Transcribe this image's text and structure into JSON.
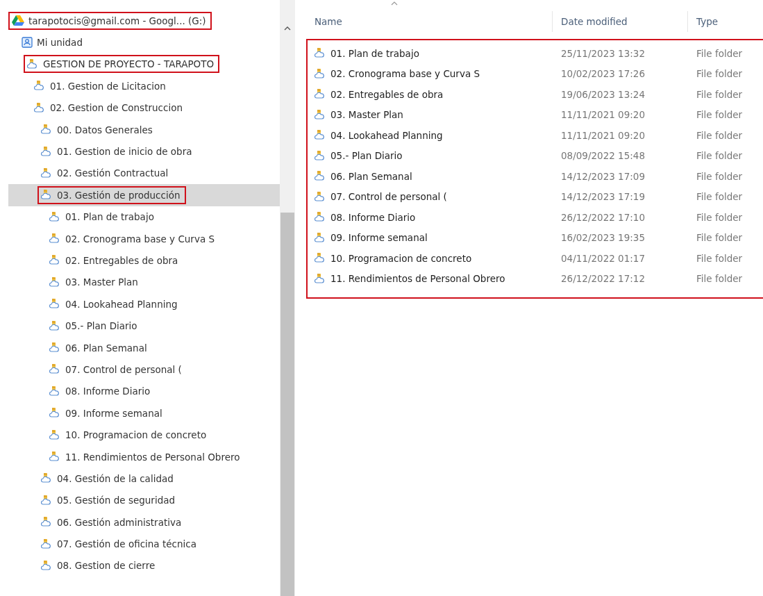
{
  "tree": [
    {
      "label": "tarapotocis@gmail.com - Googl... (G:)",
      "kind": "drive",
      "selected": false,
      "annotated": true,
      "children": [
        {
          "label": "Mi unidad",
          "kind": "mydrive",
          "selected": false,
          "annotated": false,
          "children": [
            {
              "label": "GESTION DE PROYECTO - TARAPOTO",
              "kind": "folder",
              "selected": false,
              "annotated": true,
              "children": [
                {
                  "label": "01. Gestion de Licitacion",
                  "kind": "folder",
                  "selected": false,
                  "annotated": false
                },
                {
                  "label": "02. Gestion de Construccion",
                  "kind": "folder",
                  "selected": false,
                  "annotated": false,
                  "children": [
                    {
                      "label": "00. Datos Generales",
                      "kind": "folder",
                      "selected": false,
                      "annotated": false
                    },
                    {
                      "label": "01. Gestion de inicio de obra",
                      "kind": "folder",
                      "selected": false,
                      "annotated": false
                    },
                    {
                      "label": "02. Gestión Contractual",
                      "kind": "folder",
                      "selected": false,
                      "annotated": false
                    },
                    {
                      "label": "03. Gestión de producción",
                      "kind": "folder",
                      "selected": true,
                      "annotated": true,
                      "children": [
                        {
                          "label": "01. Plan de trabajo",
                          "kind": "folder",
                          "selected": false,
                          "annotated": false
                        },
                        {
                          "label": "02. Cronograma base  y Curva S",
                          "kind": "folder",
                          "selected": false,
                          "annotated": false
                        },
                        {
                          "label": "02. Entregables de obra",
                          "kind": "folder",
                          "selected": false,
                          "annotated": false
                        },
                        {
                          "label": "03. Master Plan",
                          "kind": "folder",
                          "selected": false,
                          "annotated": false
                        },
                        {
                          "label": "04. Lookahead Planning",
                          "kind": "folder",
                          "selected": false,
                          "annotated": false
                        },
                        {
                          "label": "05.- Plan Diario",
                          "kind": "folder",
                          "selected": false,
                          "annotated": false
                        },
                        {
                          "label": "06. Plan Semanal",
                          "kind": "folder",
                          "selected": false,
                          "annotated": false
                        },
                        {
                          "label": "07. Control de personal (",
                          "kind": "folder",
                          "selected": false,
                          "annotated": false
                        },
                        {
                          "label": "08. Informe Diario",
                          "kind": "folder",
                          "selected": false,
                          "annotated": false
                        },
                        {
                          "label": "09. Informe semanal",
                          "kind": "folder",
                          "selected": false,
                          "annotated": false
                        },
                        {
                          "label": "10. Programacion de concreto",
                          "kind": "folder",
                          "selected": false,
                          "annotated": false
                        },
                        {
                          "label": "11. Rendimientos de Personal Obrero",
                          "kind": "folder",
                          "selected": false,
                          "annotated": false
                        }
                      ]
                    },
                    {
                      "label": "04. Gestión de la calidad",
                      "kind": "folder",
                      "selected": false,
                      "annotated": false
                    },
                    {
                      "label": "05. Gestión de seguridad",
                      "kind": "folder",
                      "selected": false,
                      "annotated": false
                    },
                    {
                      "label": "06. Gestión administrativa",
                      "kind": "folder",
                      "selected": false,
                      "annotated": false
                    },
                    {
                      "label": "07. Gestión de oficina técnica",
                      "kind": "folder",
                      "selected": false,
                      "annotated": false
                    },
                    {
                      "label": "08. Gestion de cierre",
                      "kind": "folder",
                      "selected": false,
                      "annotated": false
                    }
                  ]
                }
              ]
            }
          ]
        }
      ]
    }
  ],
  "file_list": {
    "columns": [
      "Name",
      "Date modified",
      "Type"
    ],
    "annotated": true,
    "rows": [
      {
        "name": "01. Plan de trabajo",
        "date": "25/11/2023 13:32",
        "type": "File folder"
      },
      {
        "name": "02. Cronograma base  y Curva S",
        "date": "10/02/2023 17:26",
        "type": "File folder"
      },
      {
        "name": "02. Entregables de obra",
        "date": "19/06/2023 13:24",
        "type": "File folder"
      },
      {
        "name": "03. Master Plan",
        "date": "11/11/2021 09:20",
        "type": "File folder"
      },
      {
        "name": "04. Lookahead Planning",
        "date": "11/11/2021 09:20",
        "type": "File folder"
      },
      {
        "name": "05.- Plan Diario",
        "date": "08/09/2022 15:48",
        "type": "File folder"
      },
      {
        "name": "06. Plan Semanal",
        "date": "14/12/2023 17:09",
        "type": "File folder"
      },
      {
        "name": "07. Control de personal (",
        "date": "14/12/2023 17:19",
        "type": "File folder"
      },
      {
        "name": "08. Informe Diario",
        "date": "26/12/2022 17:10",
        "type": "File folder"
      },
      {
        "name": "09. Informe semanal",
        "date": "16/02/2023 19:35",
        "type": "File folder"
      },
      {
        "name": "10. Programacion de concreto",
        "date": "04/11/2022 01:17",
        "type": "File folder"
      },
      {
        "name": "11. Rendimientos de Personal Obrero",
        "date": "26/12/2022 17:12",
        "type": "File folder"
      }
    ]
  }
}
